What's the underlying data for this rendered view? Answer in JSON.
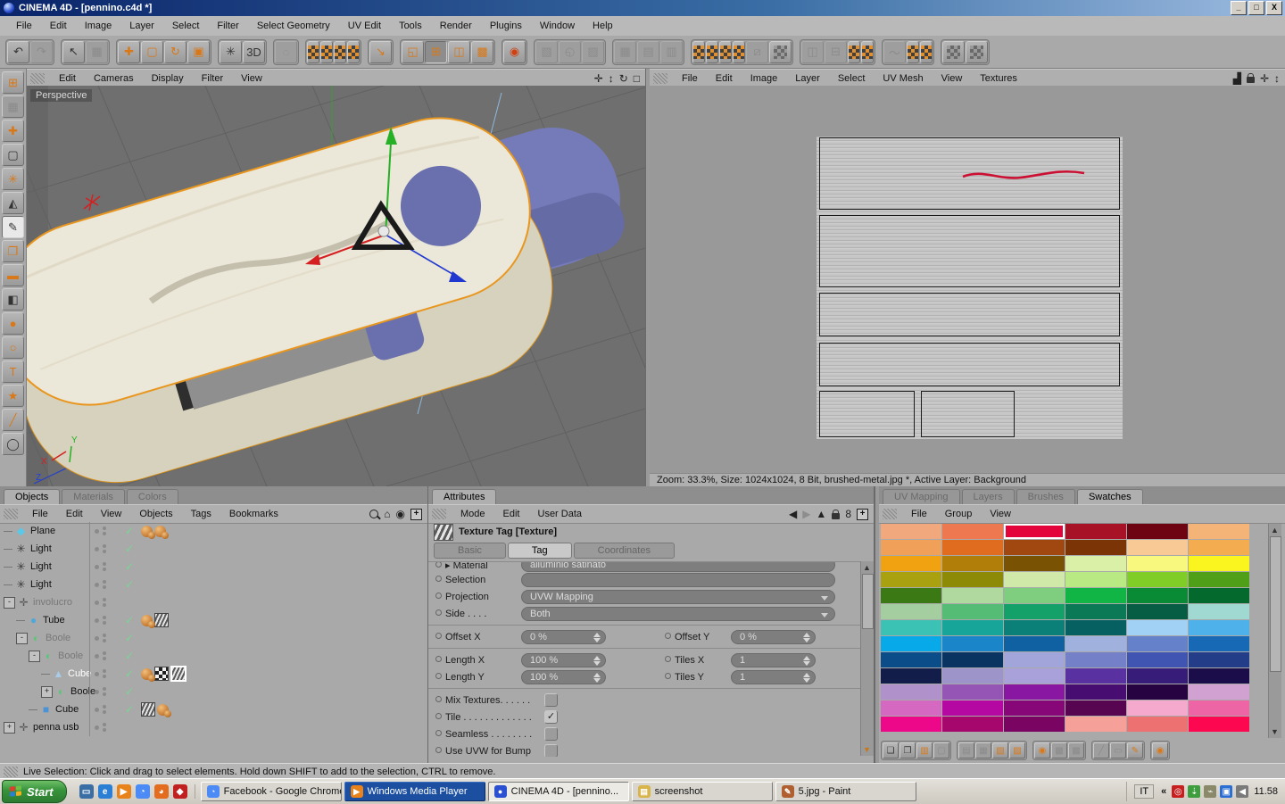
{
  "window": {
    "title": "CINEMA 4D - [pennino.c4d *]",
    "buttons": [
      "_",
      "□",
      "X"
    ]
  },
  "menubar": {
    "items": [
      "File",
      "Edit",
      "Image",
      "Layer",
      "Select",
      "Filter",
      "Select Geometry",
      "UV Edit",
      "Tools",
      "Render",
      "Plugins",
      "Window",
      "Help"
    ]
  },
  "toolbar_left": [
    [
      {
        "n": "undo",
        "g": "↶"
      },
      {
        "n": "redo",
        "g": "↷",
        "s": "d"
      }
    ],
    [
      {
        "n": "live-selection",
        "g": "↖"
      },
      {
        "n": "poly-selection",
        "g": "▦",
        "s": "d"
      }
    ],
    [
      {
        "n": "move-tool",
        "g": "✚",
        "s": "o"
      },
      {
        "n": "scale-tool",
        "g": "▢",
        "s": "o"
      },
      {
        "n": "rotate-tool",
        "g": "↻",
        "s": "o"
      },
      {
        "n": "axis-lock",
        "g": "▣",
        "s": "o"
      }
    ],
    [
      {
        "n": "magic-wand-3d",
        "g": "✳"
      },
      {
        "n": "paint-3d",
        "g": "3D"
      }
    ],
    [
      {
        "n": "sculpt",
        "g": "◌",
        "s": "d"
      }
    ],
    [
      {
        "n": "texture-decal",
        "s": "chk"
      },
      {
        "n": "texture-pattern",
        "s": "chk"
      },
      {
        "n": "texture-checker",
        "s": "chk"
      },
      {
        "n": "texture-axis",
        "s": "chk"
      }
    ],
    [
      {
        "n": "texture-coords",
        "g": "↘",
        "s": "o"
      }
    ],
    [
      {
        "n": "layout-single",
        "g": "◱",
        "s": "o"
      },
      {
        "n": "layout-quad",
        "g": "⊞",
        "s": "o p"
      },
      {
        "n": "layout-split",
        "g": "◫",
        "s": "o"
      },
      {
        "n": "layout-uv",
        "g": "▩",
        "s": "o"
      }
    ],
    [
      {
        "n": "render-view",
        "g": "◉",
        "s": "r"
      }
    ]
  ],
  "toolbar_right": [
    [
      {
        "n": "uv-relax",
        "g": "▧",
        "s": "d"
      },
      {
        "n": "uv-project",
        "g": "◵",
        "s": "d"
      },
      {
        "n": "uv-unwrap",
        "g": "▨",
        "s": "d"
      }
    ],
    [
      {
        "n": "uv-terrace",
        "g": "▦",
        "s": "d"
      },
      {
        "n": "uv-spline",
        "g": "▤",
        "s": "d"
      },
      {
        "n": "uv-restore",
        "g": "▥",
        "s": "d"
      }
    ],
    [
      {
        "n": "fit-u",
        "s": "chk"
      },
      {
        "n": "fit-v",
        "s": "chk"
      },
      {
        "n": "fit-uv",
        "s": "chk"
      },
      {
        "n": "fit-region",
        "s": "chk"
      },
      {
        "n": "uv-mirror",
        "g": "⧄",
        "s": "d"
      },
      {
        "n": "max-uv",
        "s": "chkd"
      }
    ],
    [
      {
        "n": "align-h",
        "g": "◫",
        "s": "d"
      },
      {
        "n": "align-v",
        "g": "⊟",
        "s": "d"
      },
      {
        "n": "grid-uv",
        "s": "chk"
      },
      {
        "n": "grid-uv-sel",
        "s": "chk"
      }
    ],
    [
      {
        "n": "relax-brush",
        "g": "〜",
        "s": "d"
      },
      {
        "n": "optimal-cubic",
        "s": "chk"
      },
      {
        "n": "optimal-angle",
        "s": "chk"
      }
    ],
    [
      {
        "n": "uv-transform-u",
        "g": "◱",
        "s": "chkd"
      },
      {
        "n": "uv-transform-v",
        "g": "◲",
        "s": "chkd"
      }
    ]
  ],
  "tool_palette": [
    {
      "n": "workspace-layout",
      "g": "⊞",
      "s": "o"
    },
    {
      "n": "snap-settings",
      "g": "▦",
      "s": "d"
    },
    {
      "n": "move-axes",
      "g": "✚",
      "s": "o"
    },
    {
      "n": "marquee-select",
      "g": "▢"
    },
    {
      "n": "magic-wand",
      "g": "✳",
      "s": "o"
    },
    {
      "n": "uv-mesh-tool",
      "g": "◭"
    },
    {
      "n": "paint-brush",
      "g": "✎",
      "s": "act"
    },
    {
      "n": "clone-stamp",
      "g": "❐",
      "s": "o"
    },
    {
      "n": "eraser",
      "g": "▬",
      "s": "o"
    },
    {
      "n": "gradient-tool",
      "g": "◧"
    },
    {
      "n": "smudge-drop",
      "g": "●",
      "s": "o"
    },
    {
      "n": "magnifier",
      "g": "○",
      "s": "o"
    },
    {
      "n": "text-tool",
      "g": "T",
      "s": "o"
    },
    {
      "n": "star-shape",
      "g": "★",
      "s": "o"
    },
    {
      "n": "color-picker-tool",
      "g": "╱",
      "s": "o"
    },
    {
      "n": "circle-shape",
      "g": "◯"
    }
  ],
  "viewport": {
    "menu": [
      "Edit",
      "Cameras",
      "Display",
      "Filter",
      "View"
    ],
    "label": "Perspective",
    "controls": [
      {
        "n": "vp-pan-icon",
        "g": "✛"
      },
      {
        "n": "vp-zoom-icon",
        "g": "↕"
      },
      {
        "n": "vp-rotate-icon",
        "g": "↻"
      },
      {
        "n": "vp-maximize-icon",
        "g": "□"
      }
    ],
    "axis_labels": {
      "x": "X",
      "y": "Y",
      "z": "Z"
    }
  },
  "uv_panel": {
    "menu": [
      "File",
      "Edit",
      "Image",
      "Layer",
      "Select",
      "UV Mesh",
      "View",
      "Textures"
    ],
    "status": "Zoom: 33.3%, Size: 1024x1024, 8 Bit, brushed-metal.jpg *, Active Layer: Background"
  },
  "objects_panel": {
    "tabs": [
      {
        "label": "Objects",
        "active": true
      },
      {
        "label": "Materials",
        "active": false
      },
      {
        "label": "Colors",
        "active": false
      }
    ],
    "menu": [
      "File",
      "Edit",
      "View",
      "Objects",
      "Tags",
      "Bookmarks"
    ],
    "tree": [
      {
        "name": "Plane",
        "icon": "plane",
        "level": 0,
        "check": true,
        "tags": [
          "sphere",
          "sphere"
        ]
      },
      {
        "name": "Light",
        "icon": "light",
        "level": 0,
        "check": true,
        "tags": []
      },
      {
        "name": "Light",
        "icon": "light",
        "level": 0,
        "check": true,
        "tags": []
      },
      {
        "name": "Light",
        "icon": "light",
        "level": 0,
        "check": true,
        "tags": []
      },
      {
        "name": "involucro",
        "icon": "null",
        "level": 0,
        "expander": "-",
        "dim": true,
        "tags": []
      },
      {
        "name": "Tube",
        "icon": "tube",
        "level": 1,
        "check": true,
        "tags": [
          "sphere",
          "tex"
        ]
      },
      {
        "name": "Boole",
        "icon": "boole",
        "level": 1,
        "expander": "-",
        "dim": true,
        "check": true,
        "tags": []
      },
      {
        "name": "Boole",
        "icon": "boole",
        "level": 2,
        "expander": "-",
        "dim": true,
        "check": true,
        "tags": []
      },
      {
        "name": "Cube",
        "icon": "pyramid",
        "level": 3,
        "sel": true,
        "check": true,
        "tags": [
          "sphere",
          "checker",
          "tex-sel"
        ]
      },
      {
        "name": "Boole",
        "icon": "boole",
        "level": 3,
        "expander": "+",
        "check": true,
        "tags": []
      },
      {
        "name": "Cube",
        "icon": "cube",
        "level": 2,
        "check": true,
        "tags": [
          "tex",
          "sphere"
        ]
      },
      {
        "name": "penna usb",
        "icon": "null",
        "level": 0,
        "expander": "+",
        "tags": []
      }
    ]
  },
  "attributes_panel": {
    "tab": "Attributes",
    "menu": [
      "Mode",
      "Edit",
      "User Data"
    ],
    "title": "Texture Tag [Texture]",
    "tabs": [
      {
        "label": "Basic",
        "active": false
      },
      {
        "label": "Tag",
        "active": true
      },
      {
        "label": "Coordinates",
        "active": false
      }
    ],
    "material_label": "Material",
    "material_value": "alluminio satinato",
    "selection_label": "Selection",
    "projection_label": "Projection",
    "projection_value": "UVW Mapping",
    "side_label": "Side . . . .",
    "side_value": "Both",
    "offset_x_label": "Offset X",
    "offset_x_value": "0 %",
    "offset_y_label": "Offset Y",
    "offset_y_value": "0 %",
    "length_x_label": "Length X",
    "length_x_value": "100 %",
    "tiles_x_label": "Tiles X",
    "tiles_x_value": "1",
    "length_y_label": "Length Y",
    "length_y_value": "100 %",
    "tiles_y_label": "Tiles Y",
    "tiles_y_value": "1",
    "checks": [
      {
        "label": "Mix Textures. . . . . .",
        "checked": false
      },
      {
        "label": "Tile . . . . . . . . . . . . .",
        "checked": true
      },
      {
        "label": "Seamless . . . . . . . .",
        "checked": false
      },
      {
        "label": "Use UVW for Bump",
        "checked": false
      }
    ]
  },
  "swatches_panel": {
    "tabs": [
      {
        "label": "UV Mapping",
        "active": false
      },
      {
        "label": "Layers",
        "active": false
      },
      {
        "label": "Brushes",
        "active": false
      },
      {
        "label": "Swatches",
        "active": true
      }
    ],
    "menu": [
      "File",
      "Group",
      "View"
    ],
    "selected": {
      "row": 0,
      "col": 2
    },
    "colors": [
      [
        "#F0A87C",
        "#EE7850",
        "#E4043C",
        "#A81226",
        "#6E0412",
        "#F4B377"
      ],
      [
        "#F0A058",
        "#E06C20",
        "#A04810",
        "#7A3406",
        "#F8C994",
        "#F4AC50"
      ],
      [
        "#F0A210",
        "#B27E0A",
        "#7A5204",
        "#D9F0A6",
        "#F8F87E",
        "#FAF51E"
      ],
      [
        "#A9A110",
        "#8D8A08",
        "#D0E9A8",
        "#B9E982",
        "#80CD28",
        "#4F9F18"
      ],
      [
        "#3B7914",
        "#B0D9A0",
        "#7FCD7F",
        "#10B545",
        "#088B34",
        "#04692C"
      ],
      [
        "#A4CDA0",
        "#54BC75",
        "#14A169",
        "#0B7955",
        "#075C44",
        "#A0D9D1"
      ],
      [
        "#3CC1B5",
        "#17A599",
        "#0B8079",
        "#066061",
        "#A1D1F5",
        "#4FB1E9"
      ],
      [
        "#07A9E9",
        "#1B85C9",
        "#0F61A1",
        "#A1B1DD",
        "#6481C9",
        "#1769B5"
      ],
      [
        "#0B4D89",
        "#093461",
        "#A1A5D9",
        "#7481C9",
        "#3F55B1",
        "#233D89"
      ],
      [
        "#131D49",
        "#9D95C9",
        "#A9A1D9",
        "#5931A1",
        "#371D79",
        "#1B0D49"
      ],
      [
        "#B191C9",
        "#9455B5",
        "#8917A1",
        "#470D71",
        "#270441",
        "#D1A1D1"
      ],
      [
        "#D569C1",
        "#B507A1",
        "#870779",
        "#570451",
        "#F5A9CD",
        "#ED65A5"
      ],
      [
        "#ED0789",
        "#A5076D",
        "#790461",
        "#F5A199",
        "#ED7171",
        "#FD0751"
      ]
    ],
    "tools": [
      [
        {
          "n": "new-swatch",
          "g": "❏"
        },
        {
          "n": "new-swatch-doc",
          "g": "❐"
        },
        {
          "n": "duplicate-swatch",
          "g": "▥",
          "s": "o"
        },
        {
          "n": "delete-swatch",
          "g": "▢",
          "s": "d"
        }
      ],
      [
        {
          "n": "load-swatches",
          "g": "▤",
          "s": "d"
        },
        {
          "n": "save-swatches",
          "g": "▦",
          "s": "d"
        },
        {
          "n": "copy-swatch",
          "g": "▧",
          "s": "o"
        },
        {
          "n": "paste-swatch",
          "g": "▨",
          "s": "o"
        }
      ],
      [
        {
          "n": "pick-color",
          "g": "◉",
          "s": "o"
        },
        {
          "n": "group-up",
          "g": "▩",
          "s": "d"
        },
        {
          "n": "group-down",
          "g": "▩",
          "s": "d"
        }
      ],
      [
        {
          "n": "link-brush",
          "g": "╱",
          "s": "d"
        },
        {
          "n": "edit-group",
          "g": "▭",
          "s": "d"
        },
        {
          "n": "brush-from-swatch",
          "g": "✎",
          "s": "o"
        }
      ],
      [
        {
          "n": "new-color-group",
          "g": "◉",
          "s": "o"
        }
      ]
    ]
  },
  "status_bar": {
    "text": "Live Selection: Click and drag to select elements. Hold down SHIFT to add to the selection, CTRL to remove."
  },
  "taskbar": {
    "start_label": "Start",
    "quicklaunch": [
      {
        "n": "show-desktop-icon",
        "bg": "#3A6EA5",
        "g": "▭"
      },
      {
        "n": "internet-explorer-icon",
        "bg": "#2A7FD4",
        "g": "e"
      },
      {
        "n": "media-player-icon",
        "bg": "#E8821A",
        "g": "▶"
      },
      {
        "n": "chrome-icon",
        "bg": "#4C8BF5",
        "g": "◔"
      },
      {
        "n": "firefox-icon",
        "bg": "#E46C1E",
        "g": "◕"
      },
      {
        "n": "realplayer-icon",
        "bg": "#C02020",
        "g": "◆"
      }
    ],
    "tasks": [
      {
        "label": "Facebook - Google Chrome",
        "icon_bg": "#4C8BF5",
        "icon": "◔",
        "state": "normal"
      },
      {
        "label": "Windows Media Player",
        "icon_bg": "#E8821A",
        "icon": "▶",
        "state": "activeblue"
      },
      {
        "label": "CINEMA 4D - [pennino...",
        "icon_bg": "#2A4FD0",
        "icon": "●",
        "state": "pressed"
      },
      {
        "label": "screenshot",
        "icon_bg": "#D8B44A",
        "icon": "▤",
        "state": "normal"
      },
      {
        "label": "5.jpg - Paint",
        "icon_bg": "#B06030",
        "icon": "✎",
        "state": "normal"
      }
    ],
    "tray": {
      "lang": "IT",
      "chevron": "«",
      "time": "11.58",
      "icons": [
        {
          "n": "tray-app-red-icon",
          "bg": "#C81E1E",
          "g": "◎"
        },
        {
          "n": "tray-update-icon",
          "bg": "#3E9E3E",
          "g": "⇣"
        },
        {
          "n": "tray-usb-icon",
          "bg": "#8A8A6A",
          "g": "⌁"
        },
        {
          "n": "tray-network-icon",
          "bg": "#2A6ED4",
          "g": "▣"
        },
        {
          "n": "tray-volume-icon",
          "bg": "#7A7A7A",
          "g": "◀"
        }
      ]
    }
  },
  "colors": {
    "accent_orange": "#E8961E",
    "selection_red": "#E4043C",
    "model_cream": "#EBE7D9",
    "model_blue": "#757BB9",
    "axis_x": "#D42020",
    "axis_y": "#25B025",
    "axis_z": "#2038D0"
  }
}
